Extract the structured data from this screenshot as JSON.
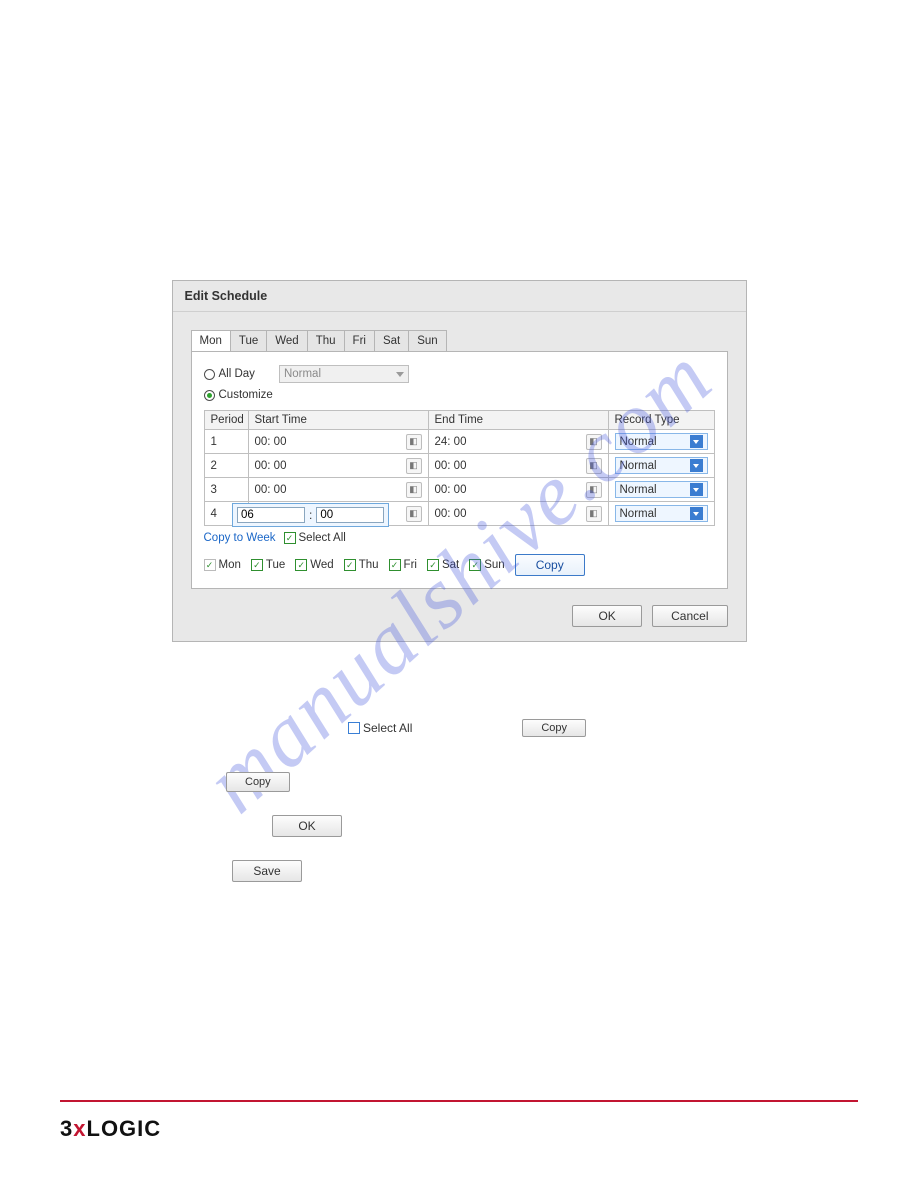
{
  "watermark": "manualshive.com",
  "dialog": {
    "title": "Edit Schedule",
    "tabs": [
      "Mon",
      "Tue",
      "Wed",
      "Thu",
      "Fri",
      "Sat",
      "Sun"
    ],
    "activeTab": "Mon",
    "mode": {
      "allDayLabel": "All Day",
      "customizeLabel": "Customize",
      "disabledSelectLabel": "Normal"
    },
    "headers": {
      "period": "Period",
      "start": "Start Time",
      "end": "End Time",
      "type": "Record Type"
    },
    "rows": [
      {
        "period": "1",
        "start": "00: 00",
        "end": "24: 00",
        "type": "Normal"
      },
      {
        "period": "2",
        "start": "00: 00",
        "end": "00: 00",
        "type": "Normal"
      },
      {
        "period": "3",
        "start": "00: 00",
        "end": "00: 00",
        "type": "Normal"
      },
      {
        "period": "4",
        "start": "00: 00",
        "end": "00: 00",
        "type": "Normal"
      }
    ],
    "timeEditor": {
      "hour": "06",
      "minute": "00",
      "sep": ":"
    },
    "copyToWeek": "Copy to Week",
    "selectAll": "Select All",
    "days": [
      "Mon",
      "Tue",
      "Wed",
      "Thu",
      "Fri",
      "Sat",
      "Sun"
    ],
    "copy": "Copy",
    "ok": "OK",
    "cancel": "Cancel"
  },
  "stray": {
    "selectAll": "Select All",
    "copy": "Copy",
    "ok": "OK",
    "save": "Save"
  },
  "brand": {
    "pre": "3",
    "x": "x",
    "post": "LOGIC"
  }
}
